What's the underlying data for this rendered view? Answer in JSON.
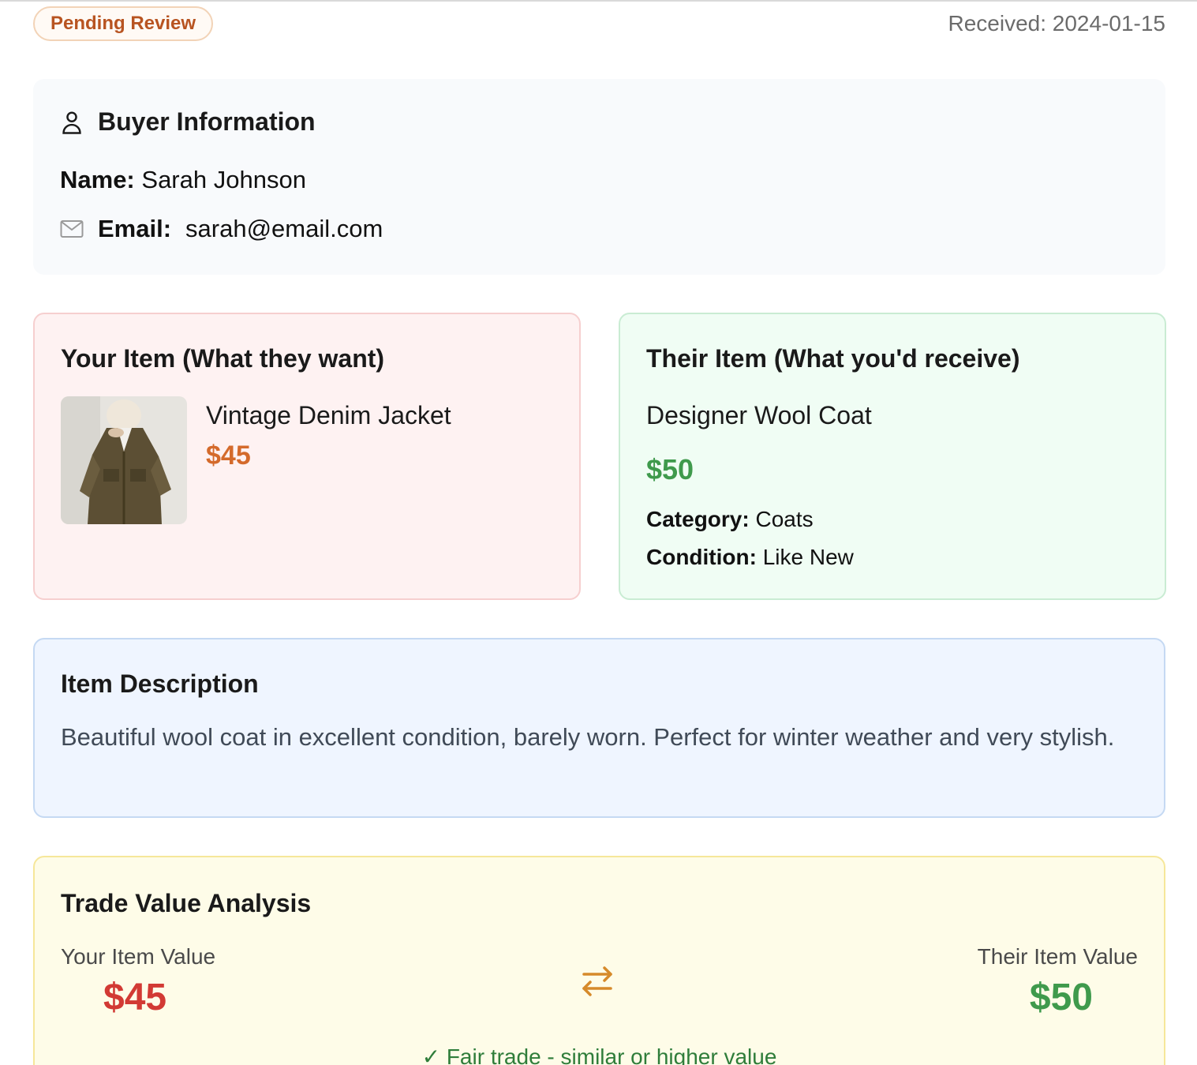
{
  "header": {
    "status": "Pending Review",
    "received": "Received: 2024-01-15"
  },
  "buyer": {
    "title": "Buyer Information",
    "name_label": "Name:",
    "name": "Sarah Johnson",
    "email_label": "Email:",
    "email": "sarah@email.com",
    "icons": {
      "title": "user-icon",
      "email": "mail-icon"
    }
  },
  "your_item": {
    "title": "Your Item (What they want)",
    "name": "Vintage Denim Jacket",
    "price": "$45"
  },
  "their_item": {
    "title": "Their Item (What you'd receive)",
    "name": "Designer Wool Coat",
    "price": "$50",
    "category_label": "Category:",
    "category": "Coats",
    "condition_label": "Condition:",
    "condition": "Like New"
  },
  "description": {
    "title": "Item Description",
    "text": "Beautiful wool coat in excellent condition, barely worn. Perfect for winter weather and very stylish."
  },
  "analysis": {
    "title": "Trade Value Analysis",
    "your_label": "Your Item Value",
    "your_value": "$45",
    "their_label": "Their Item Value",
    "their_value": "$50",
    "verdict": "✓ Fair trade - similar or higher value",
    "icon": "swap-arrows-icon"
  },
  "colors": {
    "status_text": "#b85421",
    "your_price": "#d46a2b",
    "their_price": "#3f9a4c",
    "your_value": "#d23a34",
    "verdict": "#2f7d3a"
  }
}
